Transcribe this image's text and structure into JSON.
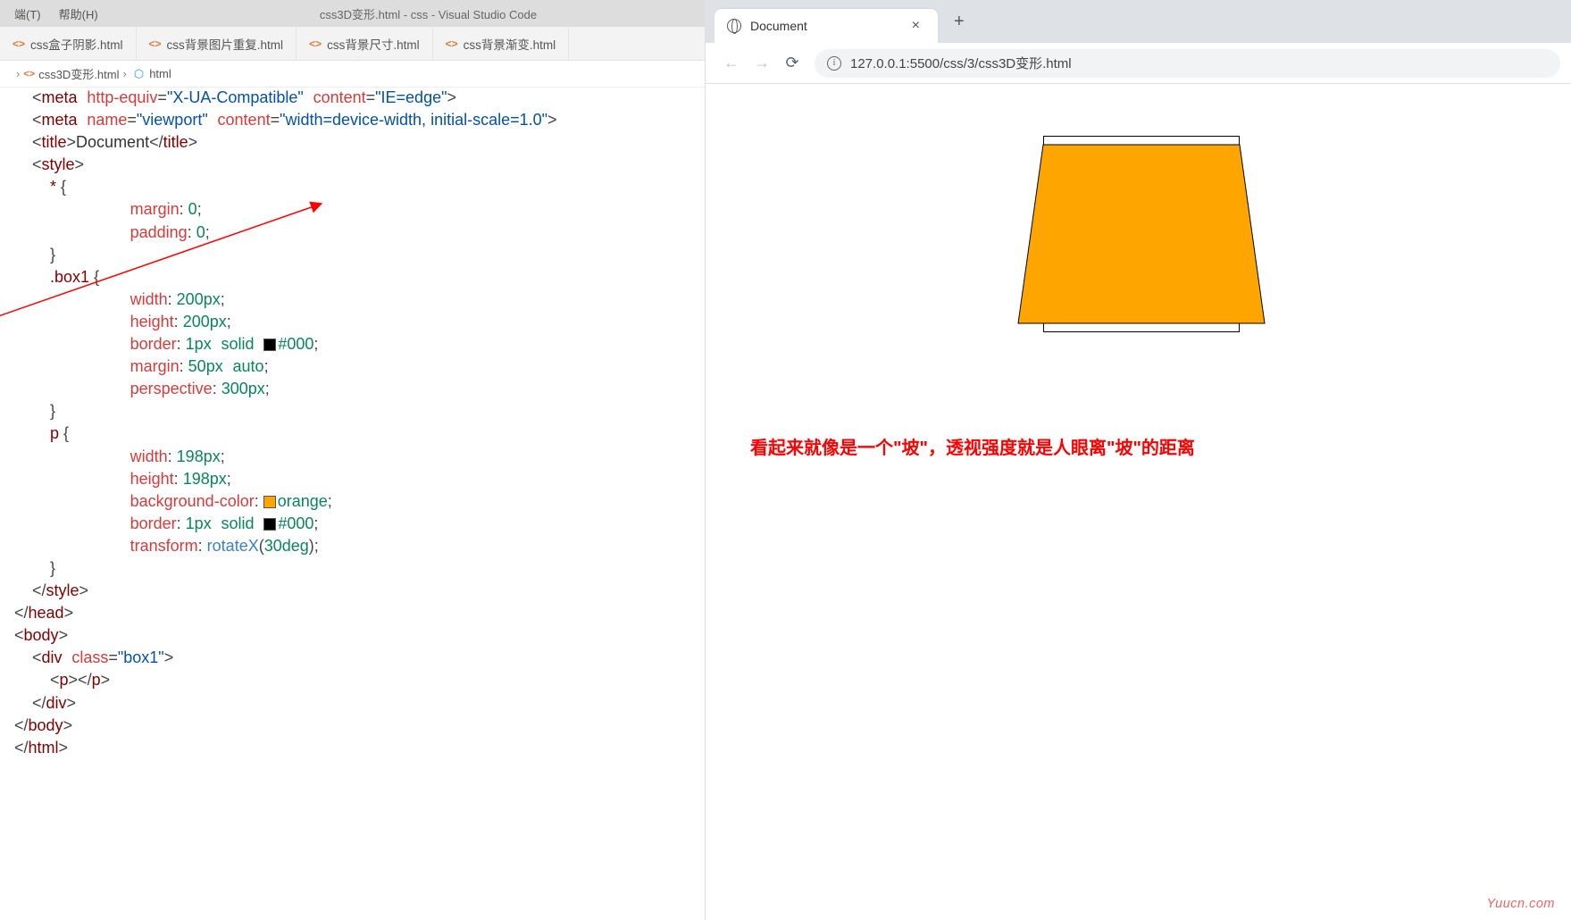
{
  "vscode": {
    "menubar": {
      "terminal": "端(T)",
      "help": "帮助(H)"
    },
    "title": "css3D变形.html - css - Visual Studio Code",
    "tabs": [
      {
        "label": "css盒子阴影.html",
        "active": false
      },
      {
        "label": "css背景图片重复.html",
        "active": false
      },
      {
        "label": "css背景尺寸.html",
        "active": false
      },
      {
        "label": "css背景渐变.html",
        "active": false
      }
    ],
    "breadcrumb": {
      "file": "css3D变形.html",
      "symbol": "html"
    },
    "code": {
      "l1": {
        "tag": "meta",
        "a1": "http-equiv",
        "v1": "\"X-UA-Compatible\"",
        "a2": "content",
        "v2": "\"IE=edge\""
      },
      "l2": {
        "tag": "meta",
        "a1": "name",
        "v1": "\"viewport\"",
        "a2": "content",
        "v2": "\"width=device-width, initial-scale=1.0\""
      },
      "l3": {
        "tag_open": "title",
        "text": "Document",
        "tag_close": "title"
      },
      "l4": {
        "tag": "style"
      },
      "sel_star": "*",
      "margin0": "margin",
      "margin0_v": "0",
      "padding0": "padding",
      "padding0_v": "0",
      "sel_box1": ".box1",
      "width": "width",
      "w200": "200px",
      "height": "height",
      "h200": "200px",
      "border": "border",
      "border_v1": "1px",
      "border_v2": "solid",
      "border_c": "#000",
      "margin": "margin",
      "m50": "50px",
      "mauto": "auto",
      "perspective": "perspective",
      "persp_v": "300px",
      "sel_p": "p",
      "w198": "198px",
      "h198": "198px",
      "bgcolor": "background-color",
      "orange": "orange",
      "transform": "transform",
      "rotate_fn": "rotateX",
      "rotate_arg": "30deg",
      "style_close": "style",
      "head_close": "head",
      "body_open": "body",
      "div_open": "div",
      "div_class_attr": "class",
      "div_class_val": "\"box1\"",
      "p_tag": "p",
      "div_close": "div",
      "body_close": "body",
      "html_close": "html"
    }
  },
  "browser": {
    "tab_title": "Document",
    "url": "127.0.0.1:5500/css/3/css3D变形.html"
  },
  "annotation": "看起来就像是一个\"坡\"，透视强度就是人眼离\"坡\"的距离",
  "watermark": "Yuucn.com"
}
